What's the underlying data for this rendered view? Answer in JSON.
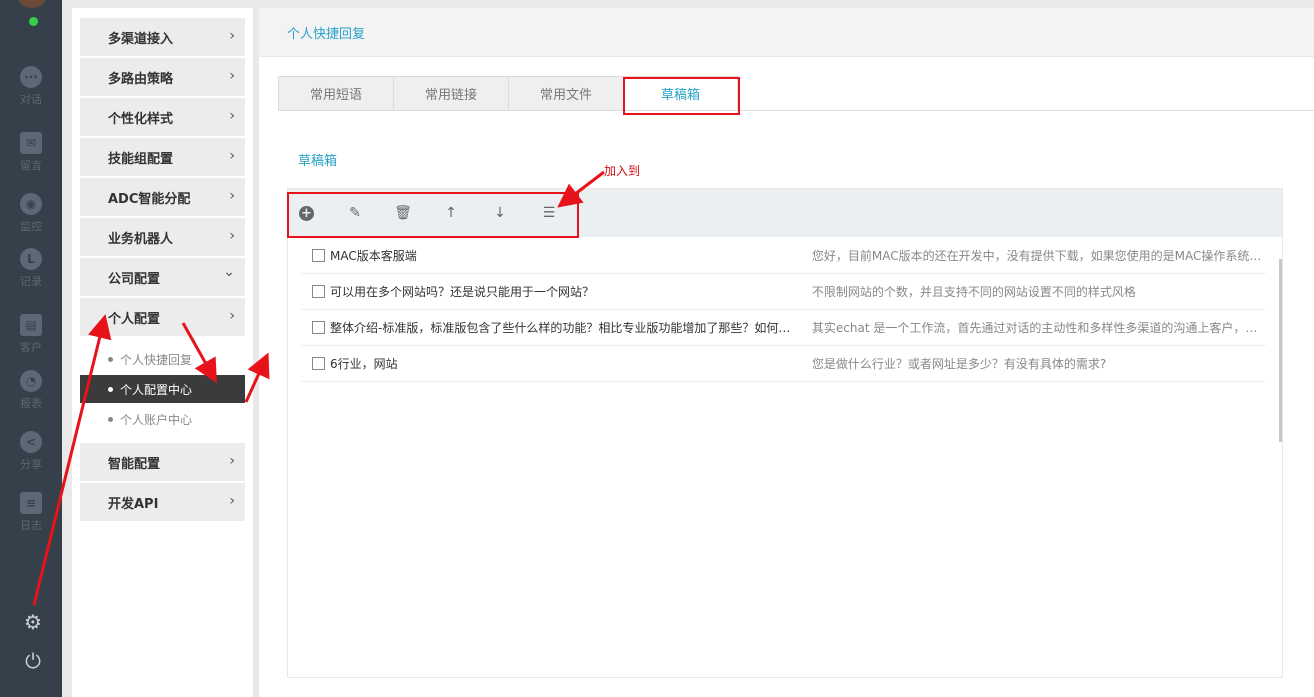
{
  "rail": {
    "items": [
      {
        "label": "对话",
        "icon": "chat-icon"
      },
      {
        "label": "留言",
        "icon": "mail-icon"
      },
      {
        "label": "监控",
        "icon": "eye-icon"
      },
      {
        "label": "记录",
        "icon": "clock-icon"
      },
      {
        "label": "客户",
        "icon": "contact-card-icon"
      },
      {
        "label": "报表",
        "icon": "pie-chart-icon"
      },
      {
        "label": "分享",
        "icon": "share-icon"
      },
      {
        "label": "日志",
        "icon": "clipboard-icon"
      }
    ],
    "settings_icon": "⚙",
    "power_icon": "⏻"
  },
  "menu": {
    "items": [
      {
        "label": "多渠道接入"
      },
      {
        "label": "多路由策略"
      },
      {
        "label": "个性化样式"
      },
      {
        "label": "技能组配置"
      },
      {
        "label": "ADC智能分配"
      },
      {
        "label": "业务机器人"
      },
      {
        "label": "公司配置"
      },
      {
        "label": "个人配置"
      },
      {
        "label": "智能配置"
      },
      {
        "label": "开发API"
      }
    ],
    "submenu": [
      {
        "label": "个人快捷回复"
      },
      {
        "label": "个人配置中心"
      },
      {
        "label": "个人账户中心"
      }
    ],
    "chev_right": "›",
    "chev_down": "⌄"
  },
  "header": {
    "title": "个人快捷回复"
  },
  "tabs": [
    {
      "label": "常用短语"
    },
    {
      "label": "常用链接"
    },
    {
      "label": "常用文件"
    },
    {
      "label": "草稿箱"
    }
  ],
  "section_title": "草稿箱",
  "toolbar": {
    "add": "+",
    "edit": "✎",
    "delete": "🗑",
    "up": "↑",
    "down": "↓",
    "list": "☰"
  },
  "rows": [
    {
      "question": "MAC版本客服端",
      "answer": "您好，目前MAC版本的还在开发中，没有提供下载，如果您使用的是MAC操作系统的..."
    },
    {
      "question": "可以用在多个网站吗？还是说只能用于一个网站？",
      "answer": "不限制网站的个数，并且支持不同的网站设置不同的样式风格"
    },
    {
      "question": "整体介绍-标准版，标准版包含了些什么样的功能？相比专业版功能增加了那些？如何做...",
      "answer": "其实echat 是一个工作流，首先通过对话的主动性和多样性多渠道的沟通上客户，然后利..."
    },
    {
      "question": "6行业，网站",
      "answer": "您是做什么行业？或者网址是多少？有没有具体的需求?"
    }
  ],
  "annotation": {
    "label": "加入到",
    "color": "#e8121b"
  }
}
